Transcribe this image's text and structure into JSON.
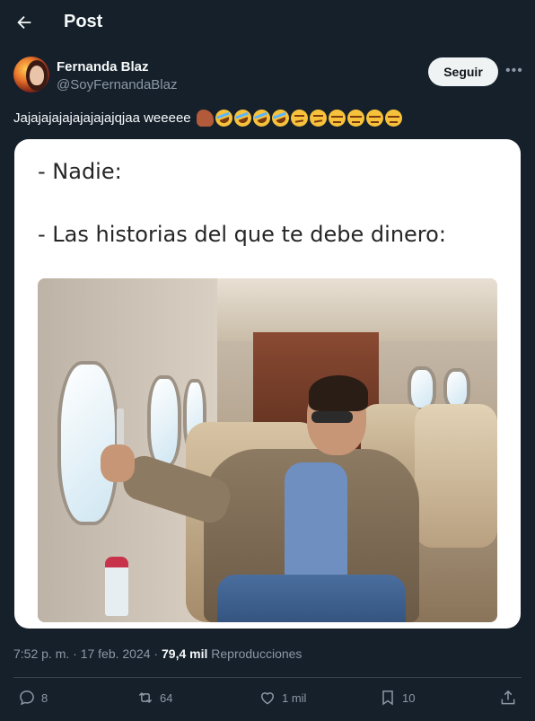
{
  "header": {
    "title": "Post"
  },
  "author": {
    "name": "Fernanda Blaz",
    "handle": "@SoyFernandaBlaz",
    "follow_label": "Seguir"
  },
  "tweet": {
    "text": "Jajajajajajajajajajqjaa weeeee",
    "emojis": [
      "horse-icon",
      "rofl-emoji",
      "rofl-emoji",
      "rofl-emoji",
      "rofl-emoji",
      "raised-eyebrow-emoji",
      "raised-eyebrow-emoji",
      "unamused-emoji",
      "unamused-emoji",
      "unamused-emoji",
      "unamused-emoji"
    ]
  },
  "media": {
    "line1": "- Nadie:",
    "line2": "- Las historias del que te debe dinero:"
  },
  "meta": {
    "time": "7:52 p. m. · 17 feb. 2024 · ",
    "views_count": "79,4 mil",
    "views_label": " Reproducciones"
  },
  "actions": {
    "replies": "8",
    "reposts": "64",
    "likes": "1 mil",
    "bookmarks": "10"
  },
  "colors": {
    "background": "#15202b",
    "text": "#f7f9f9",
    "muted": "#8b98a5",
    "divider": "#38444d"
  }
}
